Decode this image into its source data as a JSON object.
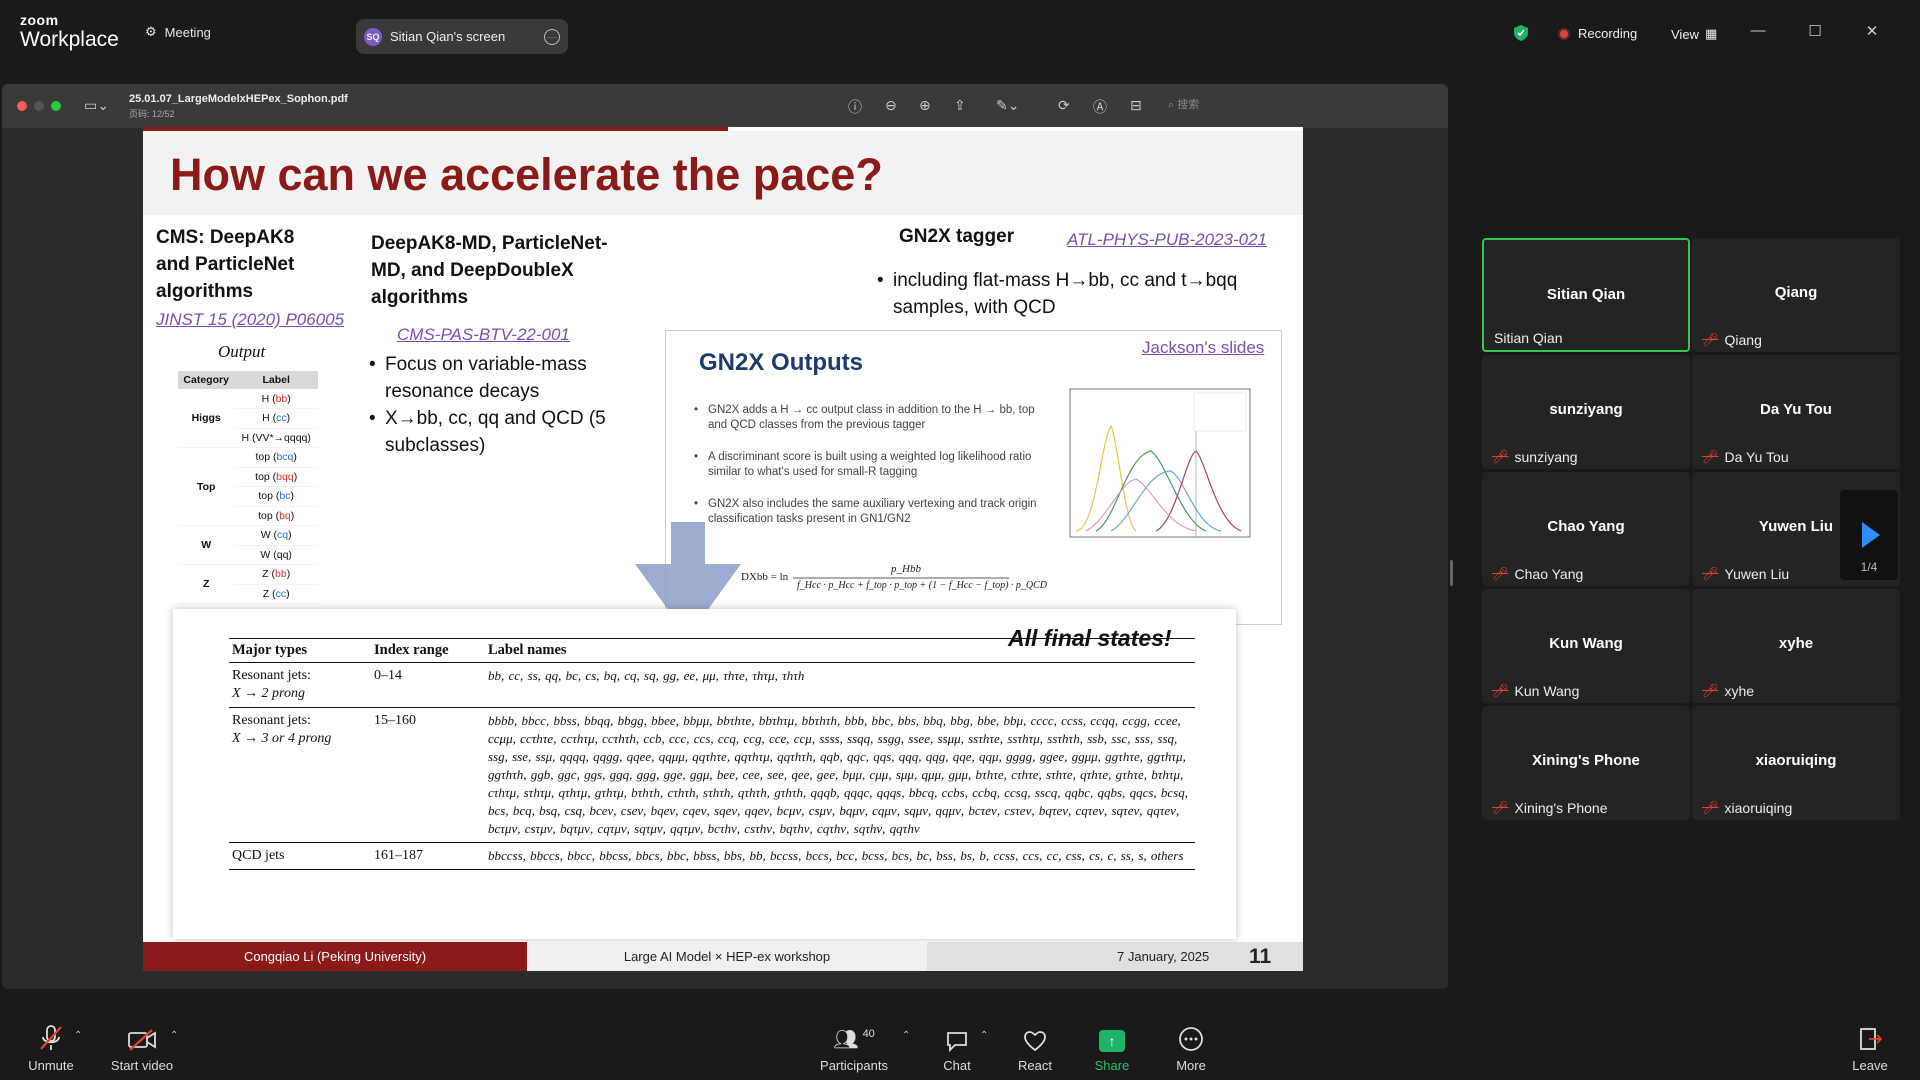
{
  "app": {
    "brand_top": "zoom",
    "brand_bottom": "Workplace",
    "meeting_label": "Meeting",
    "share_pill": {
      "initials": "SQ",
      "label": "Sitian Qian's screen"
    },
    "recording_label": "Recording",
    "view_label": "View"
  },
  "pdf": {
    "filename": "25.01.07_LargeModelxHEPex_Sophon.pdf",
    "page_info": "页码: 12/52",
    "search_placeholder": "搜索"
  },
  "slide": {
    "title": "How can we accelerate the pace?",
    "cms_heading": "CMS: DeepAK8 and ParticleNet algorithms",
    "jinst_link": "JINST 15 (2020) P06005",
    "output_label": "Output",
    "small_table": {
      "headers": [
        "Category",
        "Label"
      ],
      "rows": [
        {
          "cat": "Higgs",
          "pre": "H (",
          "hl": "bb",
          "hl_color": "red",
          "post": ")"
        },
        {
          "cat": "",
          "pre": "H (",
          "hl": "cc",
          "hl_color": "blue",
          "post": ")"
        },
        {
          "cat": "",
          "pre": "H (VV*→qqqq)",
          "hl": "",
          "hl_color": "",
          "post": ""
        },
        {
          "cat": "Top",
          "pre": "top (",
          "hl": "bcq",
          "hl_color": "blue",
          "post": ")"
        },
        {
          "cat": "",
          "pre": "top (",
          "hl": "bqq",
          "hl_color": "red",
          "post": ")"
        },
        {
          "cat": "",
          "pre": "top (",
          "hl": "bc",
          "hl_color": "blue",
          "post": ")"
        },
        {
          "cat": "",
          "pre": "top (",
          "hl": "bq",
          "hl_color": "red",
          "post": ")"
        },
        {
          "cat": "W",
          "pre": "W (",
          "hl": "cq",
          "hl_color": "blue",
          "post": ")"
        },
        {
          "cat": "",
          "pre": "W (qq)",
          "hl": "",
          "hl_color": "",
          "post": ""
        },
        {
          "cat": "Z",
          "pre": "Z (",
          "hl": "bb",
          "hl_color": "red",
          "post": ")"
        },
        {
          "cat": "",
          "pre": "Z (",
          "hl": "cc",
          "hl_color": "blue",
          "post": ")"
        }
      ]
    },
    "deep_heading": "DeepAK8-MD, ParticleNet-MD, and DeepDoubleX algorithms",
    "cms_pas_link": "CMS-PAS-BTV-22-001",
    "bullets_left": [
      "Focus on variable-mass resonance decays",
      "X→bb, cc, qq and QCD (5 subclasses)"
    ],
    "gn2x_heading": "GN2X tagger",
    "atl_link": "ATL-PHYS-PUB-2023-021",
    "bullets_right": [
      "including flat-mass H→bb, cc and t→bqq samples, with QCD"
    ],
    "gn2x_box": {
      "title": "GN2X Outputs",
      "jackson_link": "Jackson's slides",
      "bullets": [
        "GN2X adds a H → cc output class in addition to the H → bb, top and QCD classes from the previous tagger",
        "A discriminant score is built using a weighted log likelihood ratio similar to what's used for small-R tagging",
        "GN2X also includes the same auxiliary vertexing and track origin classification tasks present in GN1/GN2"
      ],
      "formula_numerator": "p_Hbb",
      "formula_denominator": "f_Hcc · p_Hcc + f_top · p_top + (1 − f_Hcc − f_top) · p_QCD"
    },
    "big_table": {
      "badge": "All final states!",
      "headers": [
        "Major types",
        "Index range",
        "Label names"
      ],
      "rows": [
        {
          "type": "Resonant jets:",
          "type2": "X → 2 prong",
          "range": "0–14",
          "names": "bb, cc, ss, qq, bc, cs, bq, cq, sq, gg, ee, μμ, τhτe, τhτμ, τhτh"
        },
        {
          "type": "Resonant jets:",
          "type2": "X → 3 or 4 prong",
          "range": "15–160",
          "names": "bbbb, bbcc, bbss, bbqq, bbgg, bbee, bbμμ, bbτhτe, bbτhτμ, bbτhτh, bbb, bbc, bbs, bbq, bbg, bbe, bbμ, cccc, ccss, ccqq, ccgg, ccee, ccμμ, ccτhτe, ccτhτμ, ccτhτh, ccb, ccc, ccs, ccq, ccg, cce, ccμ, ssss, ssqq, ssgg, ssee, ssμμ, ssτhτe, ssτhτμ, ssτhτh, ssb, ssc, sss, ssq, ssg, sse, ssμ, qqqq, qqgg, qqee, qqμμ, qqτhτe, qqτhτμ, qqτhτh, qqb, qqc, qqs, qqq, qqg, qqe, qqμ, gggg, ggee, ggμμ, ggτhτe, ggτhτμ, ggτhτh, ggb, ggc, ggs, ggq, ggg, gge, ggμ, bee, cee, see, qee, gee, bμμ, cμμ, sμμ, qμμ, gμμ, bτhτe, cτhτe, sτhτe, qτhτe, gτhτe, bτhτμ, cτhτμ, sτhτμ, qτhτμ, gτhτμ, bτhτh, cτhτh, sτhτh, qτhτh, gτhτh, qqqb, qqqc, qqqs, bbcq, ccbs, ccbq, ccsq, sscq, qqbc, qqbs, qqcs, bcsq, bcs, bcq, bsq, csq, bceν, cseν, bqeν, cqeν, sqeν, qqeν, bcμν, csμν, bqμν, cqμν, sqμν, qqμν, bcτeν, csτeν, bqτeν, cqτeν, sqτeν, qqτeν, bcτμν, csτμν, bqτμν, cqτμν, sqτμν, qqτμν, bcτhν, csτhν, bqτhν, cqτhν, sqτhν, qqτhν"
        },
        {
          "type": "QCD jets",
          "type2": "",
          "range": "161–187",
          "names": "bbccss, bbccs, bbcc, bbcss, bbcs, bbc, bbss, bbs, bb, bccss, bccs, bcc, bcss, bcs, bc, bss, bs, b, ccss, ccs, cc, css, cs, c, ss, s, others"
        }
      ]
    },
    "footer": {
      "left": "Congqiao Li (Peking University)",
      "middle": "Large AI Model × HEP-ex workshop",
      "date": "7 January, 2025",
      "page": "11"
    }
  },
  "participants": {
    "tiles": [
      {
        "name": "Sitian Qian",
        "label": "Sitian Qian",
        "muted": false,
        "active": true
      },
      {
        "name": "Qiang",
        "label": "Qiang",
        "muted": true,
        "active": false
      },
      {
        "name": "sunziyang",
        "label": "sunziyang",
        "muted": true,
        "active": false
      },
      {
        "name": "Da Yu Tou",
        "label": "Da Yu Tou",
        "muted": true,
        "active": false
      },
      {
        "name": "Chao Yang",
        "label": "Chao Yang",
        "muted": true,
        "active": false
      },
      {
        "name": "Yuwen Liu",
        "label": "Yuwen Liu",
        "muted": true,
        "active": false
      },
      {
        "name": "Kun Wang",
        "label": "Kun Wang",
        "muted": true,
        "active": false
      },
      {
        "name": "xyhe",
        "label": "xyhe",
        "muted": true,
        "active": false
      },
      {
        "name": "Xining's Phone",
        "label": "Xining's Phone",
        "muted": true,
        "active": false
      },
      {
        "name": "xiaoruiqing",
        "label": "xiaoruiqing",
        "muted": true,
        "active": false
      }
    ],
    "page_indicator": "1/4"
  },
  "toolbar": {
    "unmute": "Unmute",
    "start_video": "Start video",
    "participants": "Participants",
    "participant_count": "40",
    "chat": "Chat",
    "react": "React",
    "share": "Share",
    "more": "More",
    "leave": "Leave"
  },
  "colors": {
    "accent_red": "#8b1a1a",
    "link_purple": "#7b4fb0",
    "active_green": "#37c25a",
    "share_green": "#1fb36a",
    "zoom_blue": "#2d8cff"
  }
}
